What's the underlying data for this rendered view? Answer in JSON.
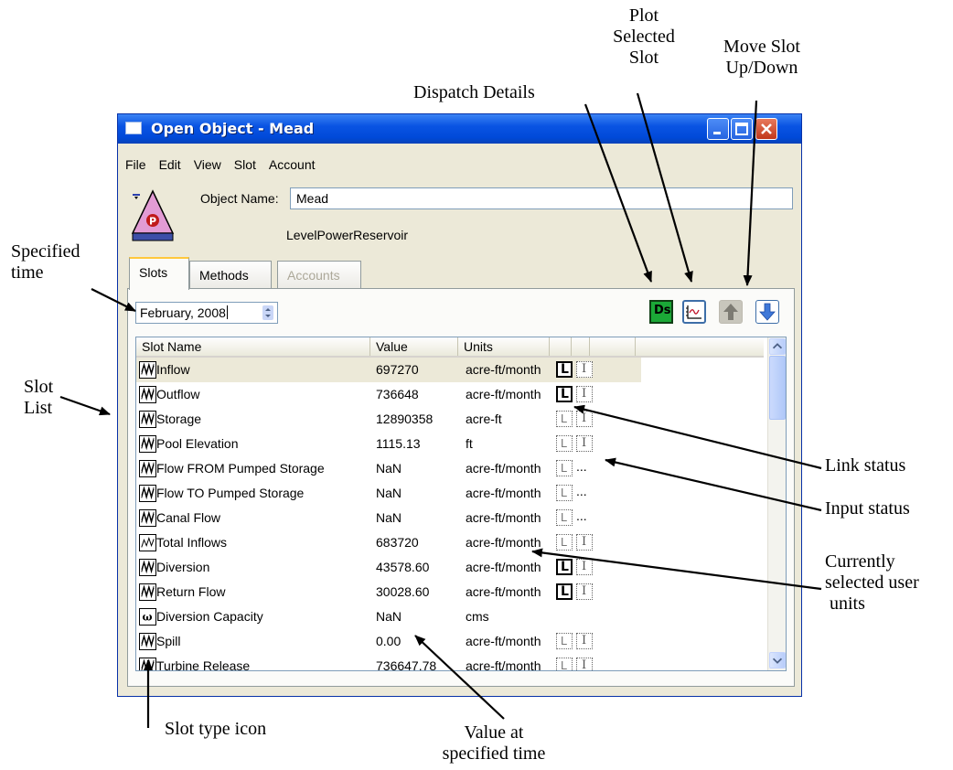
{
  "annotations": {
    "dispatch_details": "Dispatch Details",
    "plot_selected_slot": [
      "Plot",
      "Selected",
      "Slot"
    ],
    "move_slot": [
      "Move Slot",
      "Up/Down"
    ],
    "specified_time": [
      "Specified",
      "time"
    ],
    "slot_list": [
      "Slot",
      "List"
    ],
    "link_status": "Link status",
    "input_status": "Input status",
    "user_units": [
      "Currently",
      "selected user",
      " units"
    ],
    "slot_type_icon": "Slot type icon",
    "value_at_time": [
      "Value at",
      "specified time"
    ]
  },
  "window": {
    "title": "Open Object - Mead",
    "menu": [
      "File",
      "Edit",
      "View",
      "Slot",
      "Account"
    ],
    "object_name_label": "Object Name:",
    "object_name_value": "Mead",
    "object_type": "LevelPowerReservoir",
    "object_icon_letter": "P",
    "tabs": [
      "Slots",
      "Methods",
      "Accounts"
    ],
    "date": "February, 2008",
    "toolbar": {
      "dispatch": "Ds"
    },
    "columns": [
      "Slot Name",
      "Value",
      "Units"
    ],
    "rows": [
      {
        "name": "Inflow",
        "value": "697270",
        "units": "acre-ft/month",
        "link": "on",
        "input": "icon",
        "icon": "series-icon"
      },
      {
        "name": "Outflow",
        "value": "736648",
        "units": "acre-ft/month",
        "link": "on",
        "input": "icon",
        "icon": "series-icon"
      },
      {
        "name": "Storage",
        "value": "12890358",
        "units": "acre-ft",
        "link": "off",
        "input": "icon",
        "icon": "series-icon"
      },
      {
        "name": "Pool Elevation",
        "value": "1115.13",
        "units": "ft",
        "link": "off",
        "input": "icon",
        "icon": "series-icon"
      },
      {
        "name": "Flow FROM Pumped Storage",
        "value": "NaN",
        "units": "acre-ft/month",
        "link": "off",
        "input": "dots",
        "icon": "series-icon"
      },
      {
        "name": "Flow TO Pumped Storage",
        "value": "NaN",
        "units": "acre-ft/month",
        "link": "off",
        "input": "dots",
        "icon": "series-icon"
      },
      {
        "name": "Canal Flow",
        "value": "NaN",
        "units": "acre-ft/month",
        "link": "off",
        "input": "dots",
        "icon": "series-icon"
      },
      {
        "name": "Total Inflows",
        "value": "683720",
        "units": "acre-ft/month",
        "link": "off",
        "input": "icon",
        "icon": "agg-series-icon"
      },
      {
        "name": "Diversion",
        "value": "43578.60",
        "units": "acre-ft/month",
        "link": "on",
        "input": "icon",
        "icon": "series-icon"
      },
      {
        "name": "Return Flow",
        "value": "30028.60",
        "units": "acre-ft/month",
        "link": "on",
        "input": "icon",
        "icon": "series-icon"
      },
      {
        "name": "Diversion Capacity",
        "value": "NaN",
        "units": "cms",
        "link": "none",
        "input": "none",
        "icon": "scalar-icon"
      },
      {
        "name": "Spill",
        "value": "0.00",
        "units": "acre-ft/month",
        "link": "off",
        "input": "icon",
        "icon": "series-icon"
      },
      {
        "name": "Turbine Release",
        "value": "736647.78",
        "units": "acre-ft/month",
        "link": "off",
        "input": "icon",
        "icon": "series-icon"
      }
    ]
  }
}
